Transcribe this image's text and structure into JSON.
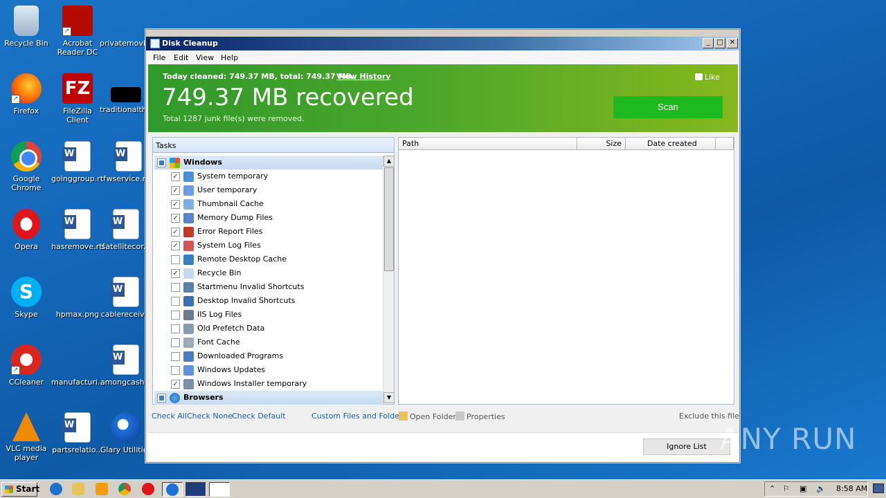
{
  "desktop": {
    "icons": [
      {
        "label": "Recycle Bin"
      },
      {
        "label": "Acrobat Reader DC"
      },
      {
        "label": "privatemovi..."
      },
      {
        "label": "Firefox"
      },
      {
        "label": "FileZilla Client"
      },
      {
        "label": "traditionalth..."
      },
      {
        "label": "Google Chrome"
      },
      {
        "label": "goinggroup.rtf"
      },
      {
        "label": "wservice.rtf"
      },
      {
        "label": "Opera"
      },
      {
        "label": "hasremove.rtf"
      },
      {
        "label": "satellitecor..."
      },
      {
        "label": "Skype"
      },
      {
        "label": "hpmax.png"
      },
      {
        "label": "cablereceiv..."
      },
      {
        "label": "CCleaner"
      },
      {
        "label": "manufacturi..."
      },
      {
        "label": "amongcash..."
      },
      {
        "label": "VLC media player"
      },
      {
        "label": "partsrelatio..."
      },
      {
        "label": "Glary Utilities"
      }
    ]
  },
  "window": {
    "title": "Disk Cleanup",
    "menu": [
      "File",
      "Edit",
      "View",
      "Help"
    ],
    "banner": {
      "today": "Today cleaned: 749.37 MB, total: 749.37 MB.",
      "view_history": "View History",
      "recovered": "749.37 MB recovered",
      "total_removed": "Total 1287 junk file(s) were removed.",
      "like": "Like",
      "scan": "Scan"
    },
    "tasks_header": "Tasks",
    "tasks": [
      {
        "label": "Windows",
        "group": true,
        "state": "partial"
      },
      {
        "label": "System temporary",
        "checked": true
      },
      {
        "label": "User temporary",
        "checked": true
      },
      {
        "label": "Thumbnail Cache",
        "checked": true
      },
      {
        "label": "Memory Dump Files",
        "checked": true
      },
      {
        "label": "Error Report Files",
        "checked": true
      },
      {
        "label": "System Log Files",
        "checked": true
      },
      {
        "label": "Remote Desktop Cache",
        "checked": false
      },
      {
        "label": "Recycle Bin",
        "checked": true
      },
      {
        "label": "Startmenu Invalid Shortcuts",
        "checked": false
      },
      {
        "label": "Desktop Invalid Shortcuts",
        "checked": false
      },
      {
        "label": "IIS Log Files",
        "checked": false
      },
      {
        "label": "Old Prefetch Data",
        "checked": false
      },
      {
        "label": "Font Cache",
        "checked": false
      },
      {
        "label": "Downloaded Programs",
        "checked": false
      },
      {
        "label": "Windows Updates",
        "checked": false
      },
      {
        "label": "Windows Installer temporary",
        "checked": true
      },
      {
        "label": "Browsers",
        "group": true,
        "state": "partial"
      }
    ],
    "columns": [
      "Path",
      "Size",
      "Date created"
    ],
    "footer": {
      "check_all": "Check All",
      "check_none": "Check None",
      "check_default": "Check Default",
      "custom": "Custom Files and Folders",
      "open_folder": "Open Folder",
      "properties": "Properties",
      "exclude": "Exclude this file",
      "ignore_list": "Ignore List"
    }
  },
  "taskbar": {
    "start": "Start",
    "clock": "8:58 AM"
  },
  "watermark": "ANY RUN"
}
